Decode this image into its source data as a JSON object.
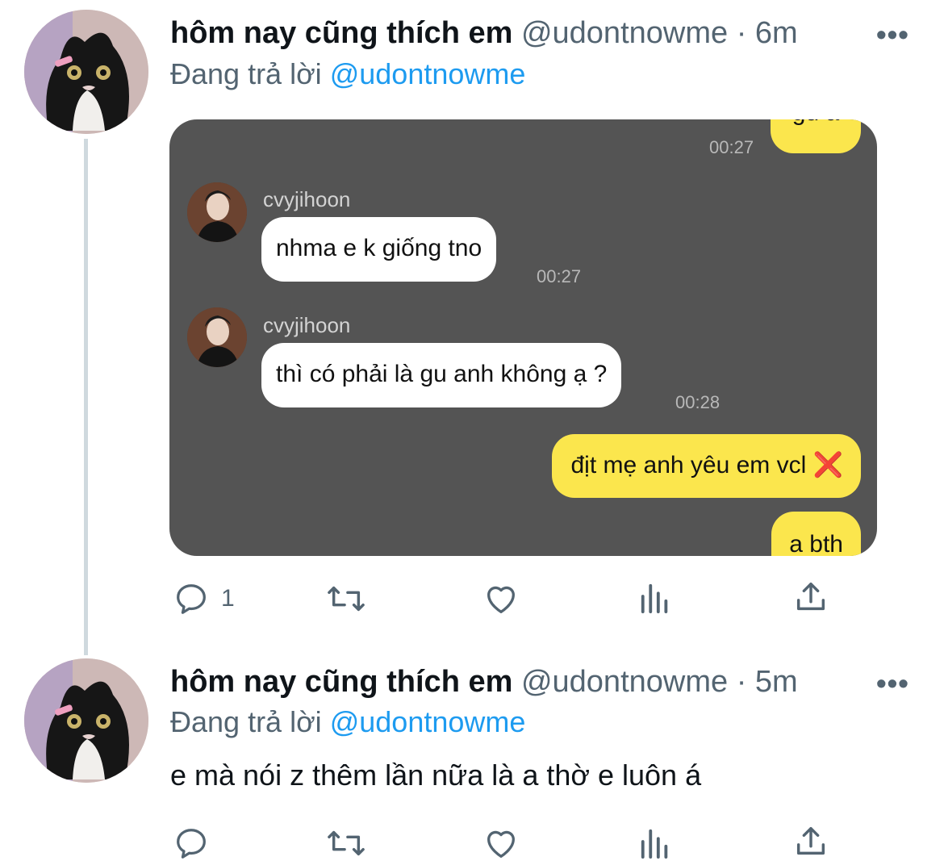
{
  "tweets": [
    {
      "display_name": "hôm nay cũng thích em",
      "handle": "@udontnowme",
      "separator": "·",
      "time": "6m",
      "reply_prefix": "Đang trả lời",
      "reply_to": "@udontnowme",
      "reply_count": "1"
    },
    {
      "display_name": "hôm nay cũng thích em",
      "handle": "@udontnowme",
      "separator": "·",
      "time": "5m",
      "reply_prefix": "Đang trả lời",
      "reply_to": "@udontnowme",
      "text": "e mà nói z thêm lần nữa là a thờ e luôn á"
    }
  ],
  "more_glyph": "•••",
  "chat": {
    "top_bubble_text": "gu a",
    "top_time": "00:27",
    "messages": [
      {
        "sender": "cvyjihoon",
        "text": "nhma e k giống tno",
        "time": "00:27"
      },
      {
        "sender": "cvyjihoon",
        "text": "thì có phải là gu anh không ạ ?",
        "time": "00:28"
      }
    ],
    "outgoing": [
      {
        "text": "địt mẹ anh yêu em vcl",
        "emoji": "❌"
      },
      {
        "text": "a bth"
      }
    ]
  },
  "colors": {
    "accent": "#1d9bf0",
    "secondary_text": "#536471",
    "chat_background": "#545454",
    "bubble_yellow": "#fbe64d"
  },
  "icons": [
    "reply-icon",
    "retweet-icon",
    "like-icon",
    "views-icon",
    "share-icon",
    "more-icon"
  ]
}
